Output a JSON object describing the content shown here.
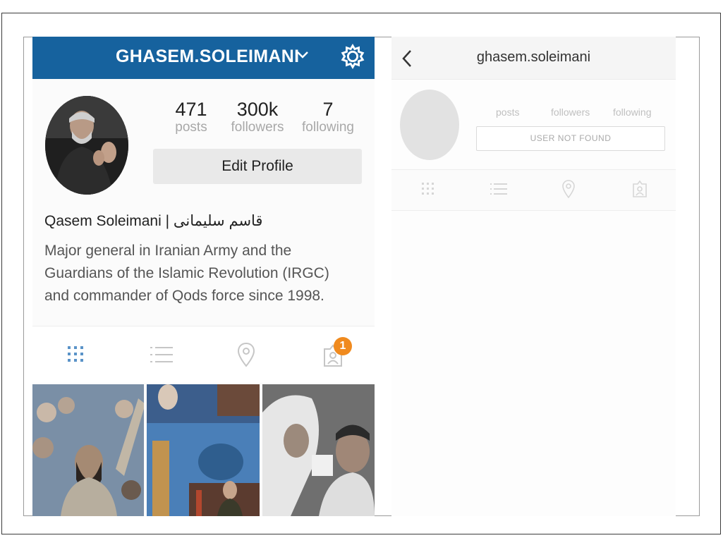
{
  "left_profile": {
    "header": {
      "username": "GHASEM.SOLEIMANI",
      "icons": [
        "chevron-down-icon",
        "gear-icon"
      ],
      "color": "#16629e"
    },
    "stats": {
      "posts": {
        "value": "471",
        "label": "posts"
      },
      "followers": {
        "value": "300k",
        "label": "followers"
      },
      "following": {
        "value": "7",
        "label": "following"
      }
    },
    "edit_profile_label": "Edit Profile",
    "full_name": "Qasem Soleimani | قاسم سلیمانی",
    "bio_lines": [
      "Major general in Iranian Army and the",
      "Guardians of the Islamic Revolution (IRGC)",
      "and commander of Qods force since 1998."
    ],
    "tabs": [
      "grid-icon",
      "list-icon",
      "location-pin-icon",
      "tagged-person-icon"
    ],
    "notification_badge": "1",
    "badge_color": "#f08a1e"
  },
  "right_profile": {
    "header": {
      "back_icon": "chevron-left-icon",
      "username": "ghasem.soleimani"
    },
    "stats": {
      "posts": "posts",
      "followers": "followers",
      "following": "following"
    },
    "status_button": "USER NOT FOUND",
    "tabs": [
      "grid-icon",
      "list-icon",
      "location-pin-icon",
      "tagged-person-icon"
    ]
  }
}
